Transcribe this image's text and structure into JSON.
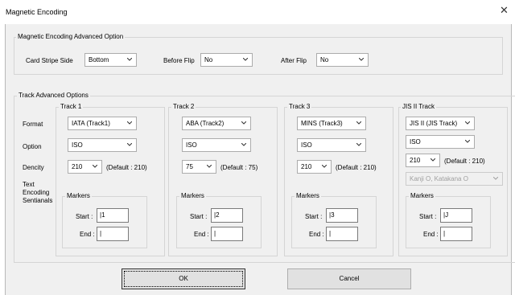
{
  "window": {
    "title": "Magnetic Encoding",
    "close_glyph": "✕"
  },
  "magnetic_option": {
    "legend": "Magnetic Encoding Advanced Option",
    "card_stripe_side_label": "Card Stripe Side",
    "card_stripe_side_value": "Bottom",
    "before_flip_label": "Before Flip",
    "before_flip_value": "No",
    "after_flip_label": "After Flip",
    "after_flip_value": "No"
  },
  "track_options": {
    "legend": "Track Advanced Options",
    "row_labels": {
      "format": "Format",
      "option": "Option",
      "dencity": "Dencity",
      "text_encoding_1": "Text",
      "text_encoding_2": "Encoding",
      "text_encoding_3": "Sentianals"
    },
    "tracks": [
      {
        "title": "Track 1",
        "format": "IATA (Track1)",
        "option": "ISO",
        "density": "210",
        "default": "(Default : 210)",
        "markers_label": "Markers",
        "start_label": "Start :",
        "start_value": "|1",
        "end_label": "End :",
        "end_value": "|"
      },
      {
        "title": "Track 2",
        "format": "ABA (Track2)",
        "option": "ISO",
        "density": "75",
        "default": "(Default : 75)",
        "markers_label": "Markers",
        "start_label": "Start :",
        "start_value": "|2",
        "end_label": "End :",
        "end_value": "|"
      },
      {
        "title": "Track 3",
        "format": "MINS (Track3)",
        "option": "ISO",
        "density": "210",
        "default": "(Default : 210)",
        "markers_label": "Markers",
        "start_label": "Start :",
        "start_value": "|3",
        "end_label": "End :",
        "end_value": "|"
      },
      {
        "title": "JIS II Track",
        "format": "JIS II (JIS Track)",
        "option": "ISO",
        "density": "210",
        "default": "(Default : 210)",
        "charset": "Kanji O, Katakana O",
        "markers_label": "Markers",
        "start_label": "Start :",
        "start_value": "|J",
        "end_label": "End :",
        "end_value": "|"
      }
    ]
  },
  "buttons": {
    "ok": "OK",
    "cancel": "Cancel"
  },
  "icons": {
    "dropdown": "chevron-down-icon",
    "close": "close-icon"
  }
}
